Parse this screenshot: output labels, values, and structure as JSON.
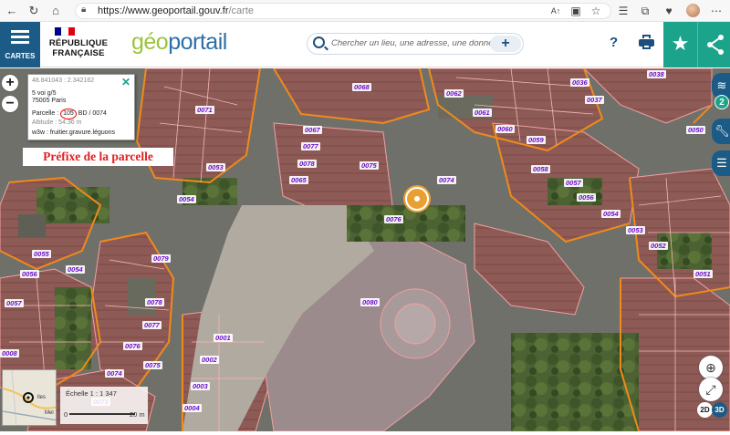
{
  "browser": {
    "url_host": "https://www.geoportail.gouv.fr",
    "url_path": "/carte"
  },
  "header": {
    "menu_label": "CARTES",
    "republic_line1": "RÉPUBLIQUE",
    "republic_line2": "FRANÇAISE",
    "logo_geo": "géo",
    "logo_portail": "portail",
    "search_placeholder": "Chercher un lieu, une adresse, une donnée",
    "help_label": "?"
  },
  "colors": {
    "menu_bg": "#1c5b86",
    "accent_teal": "#1ba38c",
    "logo_green": "#9bc43b",
    "logo_blue": "#2c6fa8",
    "parcel_label": "#6a0fc9",
    "cadastre_border": "#f08a1c",
    "marker": "#e8a032"
  },
  "popup": {
    "coords": "48.841043 : 2.342162",
    "address_line1": "5 voi g/5",
    "address_line2": "75005 Paris",
    "parcel_prefix_label": "Parcelle :",
    "parcel_prefix": "105",
    "parcel_rest": "BD / 0074",
    "altitude": "Altitude : 54.36 m",
    "w3w": "w3w : fruitier.gravure.léguons"
  },
  "annotation": "Préfixe de la parcelle",
  "parcels": [
    {
      "id": "0068"
    },
    {
      "id": "0062"
    },
    {
      "id": "0038"
    },
    {
      "id": "0036"
    },
    {
      "id": "0037"
    },
    {
      "id": "0071"
    },
    {
      "id": "0061"
    },
    {
      "id": "0060"
    },
    {
      "id": "0050"
    },
    {
      "id": "0059"
    },
    {
      "id": "0067"
    },
    {
      "id": "0077"
    },
    {
      "id": "0075"
    },
    {
      "id": "0078"
    },
    {
      "id": "0058"
    },
    {
      "id": "0053"
    },
    {
      "id": "0065"
    },
    {
      "id": "0074"
    },
    {
      "id": "0057"
    },
    {
      "id": "0054"
    },
    {
      "id": "0056"
    },
    {
      "id": "0076"
    },
    {
      "id": "0054"
    },
    {
      "id": "0053"
    },
    {
      "id": "0052"
    },
    {
      "id": "0055"
    },
    {
      "id": "0079"
    },
    {
      "id": "0056"
    },
    {
      "id": "0054"
    },
    {
      "id": "0051"
    },
    {
      "id": "0057"
    },
    {
      "id": "0078"
    },
    {
      "id": "0080"
    },
    {
      "id": "0077"
    },
    {
      "id": "0001"
    },
    {
      "id": "0076"
    },
    {
      "id": "0002"
    },
    {
      "id": "0075"
    },
    {
      "id": "0074"
    },
    {
      "id": "0003"
    },
    {
      "id": "0004"
    },
    {
      "id": "0073"
    },
    {
      "id": "0008"
    }
  ],
  "layer_count": "2",
  "view_2d": "2D",
  "view_3d": "3D",
  "minimap_label": "Mel",
  "minimap_label2": "lles",
  "scale_label": "Échelle 1 : 1 347",
  "scale_start": "0",
  "scale_end": "20 m"
}
